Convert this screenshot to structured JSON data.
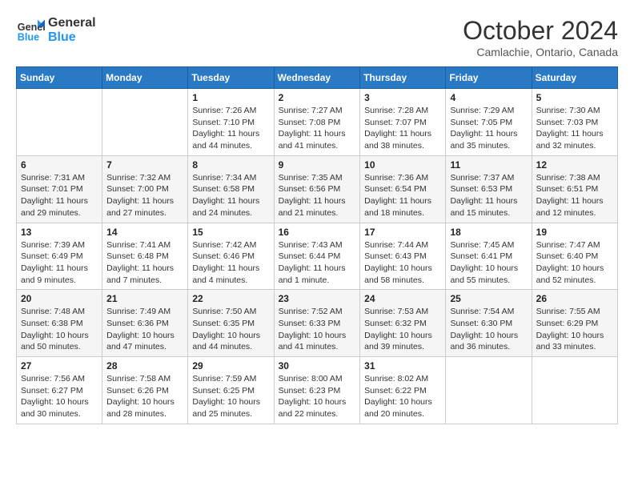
{
  "header": {
    "logo_line1": "General",
    "logo_line2": "Blue",
    "month_title": "October 2024",
    "subtitle": "Camlachie, Ontario, Canada"
  },
  "weekdays": [
    "Sunday",
    "Monday",
    "Tuesday",
    "Wednesday",
    "Thursday",
    "Friday",
    "Saturday"
  ],
  "weeks": [
    [
      {
        "day": "",
        "info": ""
      },
      {
        "day": "",
        "info": ""
      },
      {
        "day": "1",
        "info": "Sunrise: 7:26 AM\nSunset: 7:10 PM\nDaylight: 11 hours and 44 minutes."
      },
      {
        "day": "2",
        "info": "Sunrise: 7:27 AM\nSunset: 7:08 PM\nDaylight: 11 hours and 41 minutes."
      },
      {
        "day": "3",
        "info": "Sunrise: 7:28 AM\nSunset: 7:07 PM\nDaylight: 11 hours and 38 minutes."
      },
      {
        "day": "4",
        "info": "Sunrise: 7:29 AM\nSunset: 7:05 PM\nDaylight: 11 hours and 35 minutes."
      },
      {
        "day": "5",
        "info": "Sunrise: 7:30 AM\nSunset: 7:03 PM\nDaylight: 11 hours and 32 minutes."
      }
    ],
    [
      {
        "day": "6",
        "info": "Sunrise: 7:31 AM\nSunset: 7:01 PM\nDaylight: 11 hours and 29 minutes."
      },
      {
        "day": "7",
        "info": "Sunrise: 7:32 AM\nSunset: 7:00 PM\nDaylight: 11 hours and 27 minutes."
      },
      {
        "day": "8",
        "info": "Sunrise: 7:34 AM\nSunset: 6:58 PM\nDaylight: 11 hours and 24 minutes."
      },
      {
        "day": "9",
        "info": "Sunrise: 7:35 AM\nSunset: 6:56 PM\nDaylight: 11 hours and 21 minutes."
      },
      {
        "day": "10",
        "info": "Sunrise: 7:36 AM\nSunset: 6:54 PM\nDaylight: 11 hours and 18 minutes."
      },
      {
        "day": "11",
        "info": "Sunrise: 7:37 AM\nSunset: 6:53 PM\nDaylight: 11 hours and 15 minutes."
      },
      {
        "day": "12",
        "info": "Sunrise: 7:38 AM\nSunset: 6:51 PM\nDaylight: 11 hours and 12 minutes."
      }
    ],
    [
      {
        "day": "13",
        "info": "Sunrise: 7:39 AM\nSunset: 6:49 PM\nDaylight: 11 hours and 9 minutes."
      },
      {
        "day": "14",
        "info": "Sunrise: 7:41 AM\nSunset: 6:48 PM\nDaylight: 11 hours and 7 minutes."
      },
      {
        "day": "15",
        "info": "Sunrise: 7:42 AM\nSunset: 6:46 PM\nDaylight: 11 hours and 4 minutes."
      },
      {
        "day": "16",
        "info": "Sunrise: 7:43 AM\nSunset: 6:44 PM\nDaylight: 11 hours and 1 minute."
      },
      {
        "day": "17",
        "info": "Sunrise: 7:44 AM\nSunset: 6:43 PM\nDaylight: 10 hours and 58 minutes."
      },
      {
        "day": "18",
        "info": "Sunrise: 7:45 AM\nSunset: 6:41 PM\nDaylight: 10 hours and 55 minutes."
      },
      {
        "day": "19",
        "info": "Sunrise: 7:47 AM\nSunset: 6:40 PM\nDaylight: 10 hours and 52 minutes."
      }
    ],
    [
      {
        "day": "20",
        "info": "Sunrise: 7:48 AM\nSunset: 6:38 PM\nDaylight: 10 hours and 50 minutes."
      },
      {
        "day": "21",
        "info": "Sunrise: 7:49 AM\nSunset: 6:36 PM\nDaylight: 10 hours and 47 minutes."
      },
      {
        "day": "22",
        "info": "Sunrise: 7:50 AM\nSunset: 6:35 PM\nDaylight: 10 hours and 44 minutes."
      },
      {
        "day": "23",
        "info": "Sunrise: 7:52 AM\nSunset: 6:33 PM\nDaylight: 10 hours and 41 minutes."
      },
      {
        "day": "24",
        "info": "Sunrise: 7:53 AM\nSunset: 6:32 PM\nDaylight: 10 hours and 39 minutes."
      },
      {
        "day": "25",
        "info": "Sunrise: 7:54 AM\nSunset: 6:30 PM\nDaylight: 10 hours and 36 minutes."
      },
      {
        "day": "26",
        "info": "Sunrise: 7:55 AM\nSunset: 6:29 PM\nDaylight: 10 hours and 33 minutes."
      }
    ],
    [
      {
        "day": "27",
        "info": "Sunrise: 7:56 AM\nSunset: 6:27 PM\nDaylight: 10 hours and 30 minutes."
      },
      {
        "day": "28",
        "info": "Sunrise: 7:58 AM\nSunset: 6:26 PM\nDaylight: 10 hours and 28 minutes."
      },
      {
        "day": "29",
        "info": "Sunrise: 7:59 AM\nSunset: 6:25 PM\nDaylight: 10 hours and 25 minutes."
      },
      {
        "day": "30",
        "info": "Sunrise: 8:00 AM\nSunset: 6:23 PM\nDaylight: 10 hours and 22 minutes."
      },
      {
        "day": "31",
        "info": "Sunrise: 8:02 AM\nSunset: 6:22 PM\nDaylight: 10 hours and 20 minutes."
      },
      {
        "day": "",
        "info": ""
      },
      {
        "day": "",
        "info": ""
      }
    ]
  ]
}
